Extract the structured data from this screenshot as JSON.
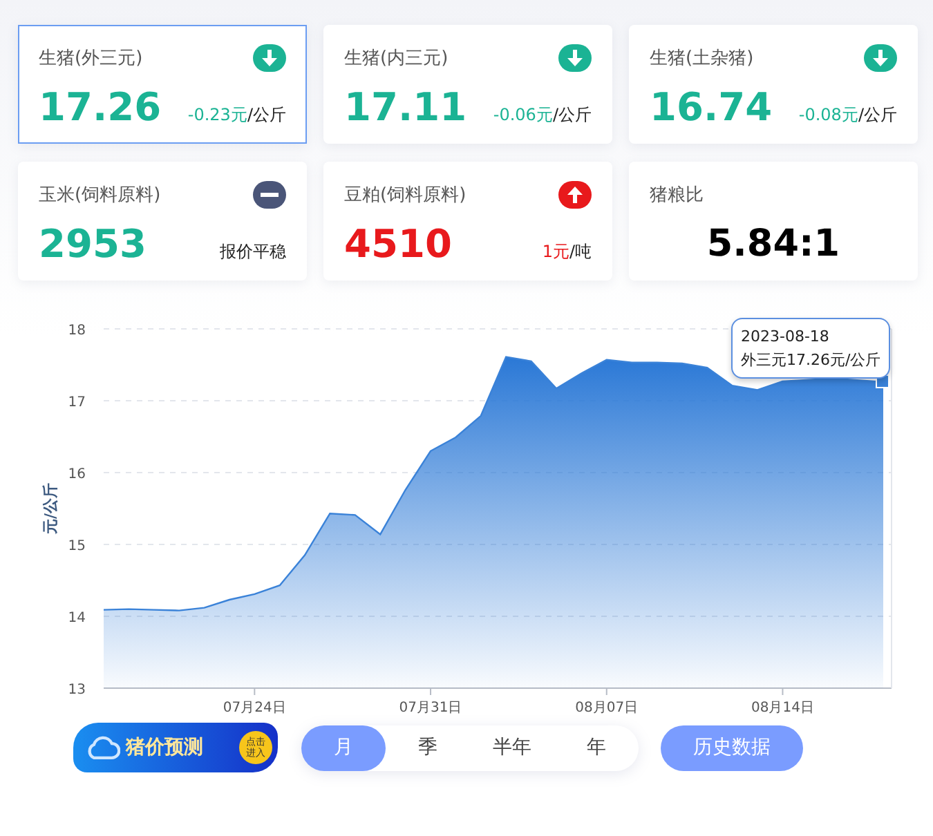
{
  "cards": [
    {
      "label": "生猪(外三元)",
      "value": "17.26",
      "change_amount": "-0.23元",
      "change_unit": "/公斤",
      "kind": "down",
      "selected": true
    },
    {
      "label": "生猪(内三元)",
      "value": "17.11",
      "change_amount": "-0.06元",
      "change_unit": "/公斤",
      "kind": "down",
      "selected": false
    },
    {
      "label": "生猪(土杂猪)",
      "value": "16.74",
      "change_amount": "-0.08元",
      "change_unit": "/公斤",
      "kind": "down",
      "selected": false
    },
    {
      "label": "玉米(饲料原料)",
      "value": "2953",
      "change_unit": "报价平稳",
      "kind": "flat",
      "selected": false
    },
    {
      "label": "豆粕(饲料原料)",
      "value": "4510",
      "change_amount": "1元",
      "change_unit": "/吨",
      "kind": "up",
      "selected": false
    },
    {
      "label": "猪粮比",
      "value": "5.84:1",
      "kind": "ratio",
      "selected": false
    }
  ],
  "chart": {
    "tooltip": {
      "date": "2023-08-18",
      "text": "外三元17.26元/公斤"
    },
    "chart_data": {
      "type": "area",
      "ylabel": "元/公斤",
      "categories": [
        null,
        null,
        null,
        null,
        null,
        null,
        "07月24日",
        null,
        null,
        null,
        null,
        null,
        null,
        "07月31日",
        null,
        null,
        null,
        null,
        null,
        null,
        "08月07日",
        null,
        null,
        null,
        null,
        null,
        null,
        "08月14日",
        null,
        null,
        null,
        null
      ],
      "grid": true,
      "series": [
        {
          "color": "#3a82d8",
          "values": [
            14.09,
            14.1,
            14.09,
            14.08,
            14.12,
            14.23,
            14.31,
            14.43,
            14.85,
            15.43,
            15.41,
            15.14,
            15.76,
            16.3,
            16.49,
            16.79,
            17.61,
            17.55,
            17.17,
            17.38,
            17.57,
            17.53,
            17.53,
            17.52,
            17.46,
            17.21,
            17.15,
            17.27,
            null,
            17.31,
            null,
            17.26
          ]
        }
      ],
      "yticks": [
        13,
        14,
        15,
        16,
        17,
        18
      ],
      "ylim": [
        13,
        18
      ]
    }
  },
  "footer": {
    "banner": {
      "title": "猪价预测",
      "badge": "点击进入"
    },
    "periods": [
      {
        "label": "月",
        "selected": true
      },
      {
        "label": "季",
        "selected": false
      },
      {
        "label": "半年",
        "selected": false
      },
      {
        "label": "年",
        "selected": false
      }
    ],
    "history_button": "历史数据"
  }
}
